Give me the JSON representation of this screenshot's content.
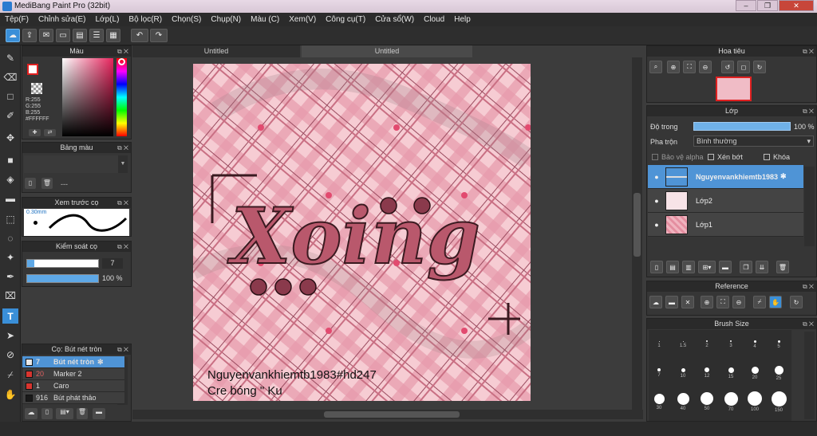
{
  "app": {
    "title": "MediBang Paint Pro (32bit)"
  },
  "window": {
    "minimize": "–",
    "restore": "❐",
    "close": "✕"
  },
  "menu": [
    "Tệp(F)",
    "Chỉnh sửa(E)",
    "Lớp(L)",
    "Bộ lọc(R)",
    "Chọn(S)",
    "Chụp(N)",
    "Màu (C)",
    "Xem(V)",
    "Công cụ(T)",
    "Cửa sổ(W)",
    "Cloud",
    "Help"
  ],
  "tabs": [
    "Untitled",
    "Untitled"
  ],
  "color_panel": {
    "title": "Màu",
    "r": "R:255",
    "g": "G:255",
    "b": "B:255",
    "hex": "#FFFFFF"
  },
  "palette_panel": {
    "title": "Bảng màu",
    "dash": "---"
  },
  "brush_preview": {
    "title": "Xem trước cọ",
    "size": "0.30mm"
  },
  "brush_control": {
    "title": "Kiểm soát cọ",
    "size_value": "7",
    "opacity_value": "100 %",
    "size_fraction": 0.1,
    "opacity_fraction": 1.0
  },
  "brush_list": {
    "title": "Cọ: Bút nét tròn",
    "items": [
      {
        "num": "7",
        "name": "Bút nét tròn",
        "color": "#e8e8e8",
        "selected": true
      },
      {
        "num": "20",
        "name": "Marker 2",
        "color": "#d8352f",
        "selected": false
      },
      {
        "num": "1",
        "name": "Caro",
        "color": "#d8352f",
        "selected": false
      },
      {
        "num": "916",
        "name": "Bút phát thảo",
        "color": "#1a1a1a",
        "selected": false
      }
    ]
  },
  "navigator": {
    "title": "Hoa tiêu"
  },
  "layer_panel": {
    "title": "Lớp",
    "opacity_label": "Độ trong",
    "opacity_value": "100 %",
    "blend_label": "Pha trộn",
    "blend_value": "Bình thường",
    "protect_alpha": "Bảo vệ alpha",
    "clip": "Xén bớt",
    "lock": "Khóa",
    "layers": [
      {
        "name": "Nguyenvankhiemtb1983",
        "selected": true
      },
      {
        "name": "Lớp2",
        "selected": false
      },
      {
        "name": "Lớp1",
        "selected": false
      }
    ]
  },
  "reference_panel": {
    "title": "Reference"
  },
  "brush_size_panel": {
    "title": "Brush Size",
    "row1": [
      "1",
      "1.5",
      "2",
      "3",
      "4",
      "5"
    ],
    "row2": [
      "7",
      "10",
      "12",
      "15",
      "20",
      "25"
    ],
    "row3": [
      "30",
      "40",
      "50",
      "70",
      "100",
      "150"
    ]
  },
  "artwork": {
    "title_text": "Xoing",
    "signature1": "Nguyenvankhiemtb1983#hd247",
    "signature2": "Cre bóng \" Ku"
  }
}
